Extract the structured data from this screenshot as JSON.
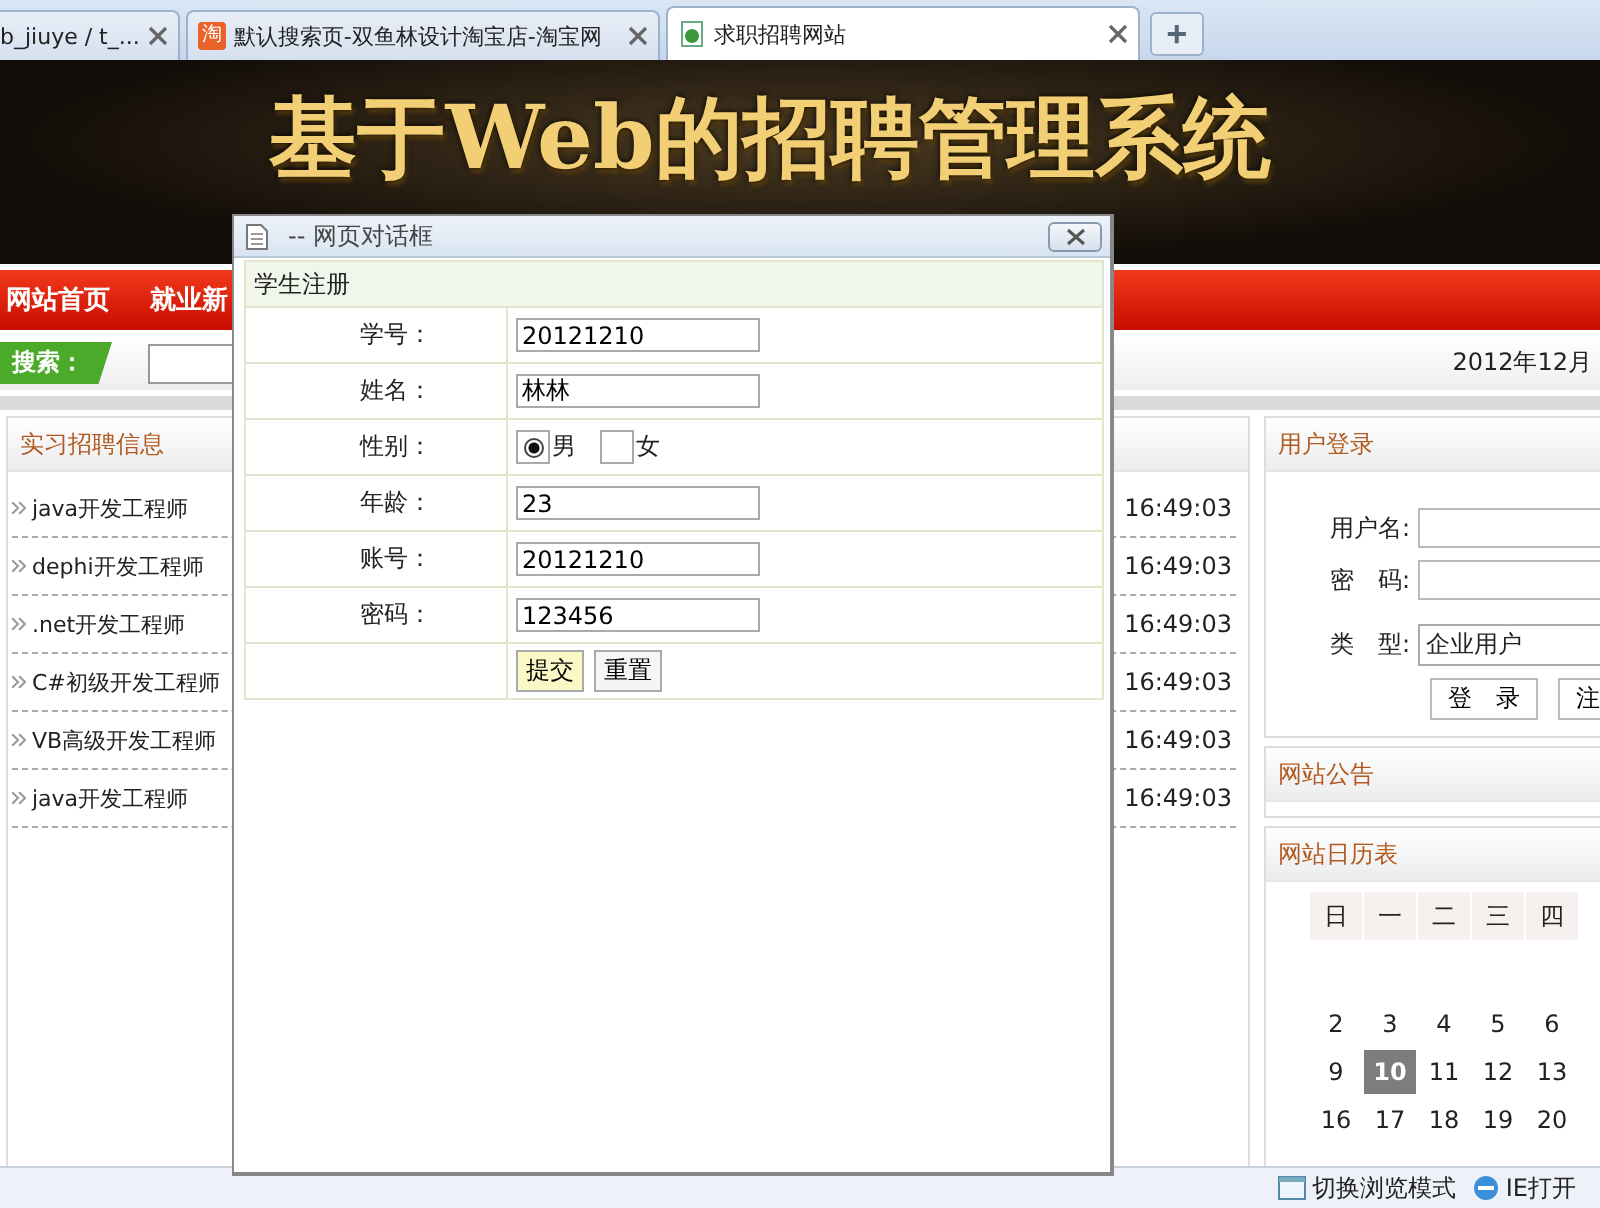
{
  "browser_tabs": [
    {
      "kind": "plain",
      "title": "b_jiuye / t_...",
      "selected": false
    },
    {
      "kind": "shop",
      "badge": "淘",
      "title": "默认搜索页-双鱼林设计淘宝店-淘宝网",
      "selected": false
    },
    {
      "kind": "page",
      "title": "求职招聘网站",
      "selected": true
    }
  ],
  "new_tab_button": "+",
  "banner": {
    "title": "基于Web的招聘管理系统"
  },
  "nav": [
    {
      "label": "网站首页"
    },
    {
      "label": "就业新"
    }
  ],
  "search": {
    "label": "搜索：",
    "date": "2012年12月"
  },
  "jobs": {
    "title": "实习招聘信息",
    "items": [
      {
        "name": "java开发工程师",
        "time": "16:49:03"
      },
      {
        "name": "dephi开发工程师",
        "time": "16:49:03"
      },
      {
        "name": ".net开发工程师",
        "time": "16:49:03"
      },
      {
        "name": "C#初级开发工程师",
        "time": "16:49:03"
      },
      {
        "name": "VB高级开发工程师",
        "time": "16:49:03"
      },
      {
        "name": "java开发工程师",
        "time": "16:49:03"
      }
    ]
  },
  "login": {
    "title": "用户登录",
    "fields": [
      {
        "label": "用户名:"
      },
      {
        "label": "密　码:"
      }
    ],
    "type_label": "类　型:",
    "type_value": "企业用户",
    "buttons": [
      "登　录",
      "注"
    ]
  },
  "notice": {
    "title": "网站公告"
  },
  "calendar": {
    "title": "网站日历表",
    "weekdays": [
      "日",
      "一",
      "二",
      "三",
      "四"
    ],
    "weeks": [
      [
        {
          "day": "2",
          "selected": false
        },
        {
          "day": "3",
          "selected": false
        },
        {
          "day": "4",
          "selected": false
        },
        {
          "day": "5",
          "selected": false
        },
        {
          "day": "6",
          "selected": false
        }
      ],
      [
        {
          "day": "9",
          "selected": false
        },
        {
          "day": "10",
          "selected": true
        },
        {
          "day": "11",
          "selected": false
        },
        {
          "day": "12",
          "selected": false
        },
        {
          "day": "13",
          "selected": false
        }
      ],
      [
        {
          "day": "16",
          "selected": false
        },
        {
          "day": "17",
          "selected": false
        },
        {
          "day": "18",
          "selected": false
        },
        {
          "day": "19",
          "selected": false
        },
        {
          "day": "20",
          "selected": false
        }
      ]
    ]
  },
  "dialog": {
    "title": "-- 网页对话框",
    "form_title": "学生注册",
    "fields": [
      {
        "kind": "text",
        "label": "学号：",
        "value": "20121210"
      },
      {
        "kind": "text",
        "label": "姓名：",
        "value": "林林"
      },
      {
        "kind": "radio",
        "label": "性别：",
        "options": [
          {
            "label": "男",
            "selected": true
          },
          {
            "label": "女",
            "selected": false
          }
        ]
      },
      {
        "kind": "text",
        "label": "年龄：",
        "value": "23"
      },
      {
        "kind": "text",
        "label": "账号：",
        "value": "20121210"
      },
      {
        "kind": "text",
        "label": "密码：",
        "value": "123456"
      }
    ],
    "buttons": [
      {
        "kind": "primary",
        "label": "提交"
      },
      {
        "kind": "plain",
        "label": "重置"
      }
    ]
  },
  "status_bar": [
    {
      "kind": "folder",
      "label": "切换浏览模式"
    },
    {
      "kind": "ie",
      "label": "IE打开"
    }
  ]
}
